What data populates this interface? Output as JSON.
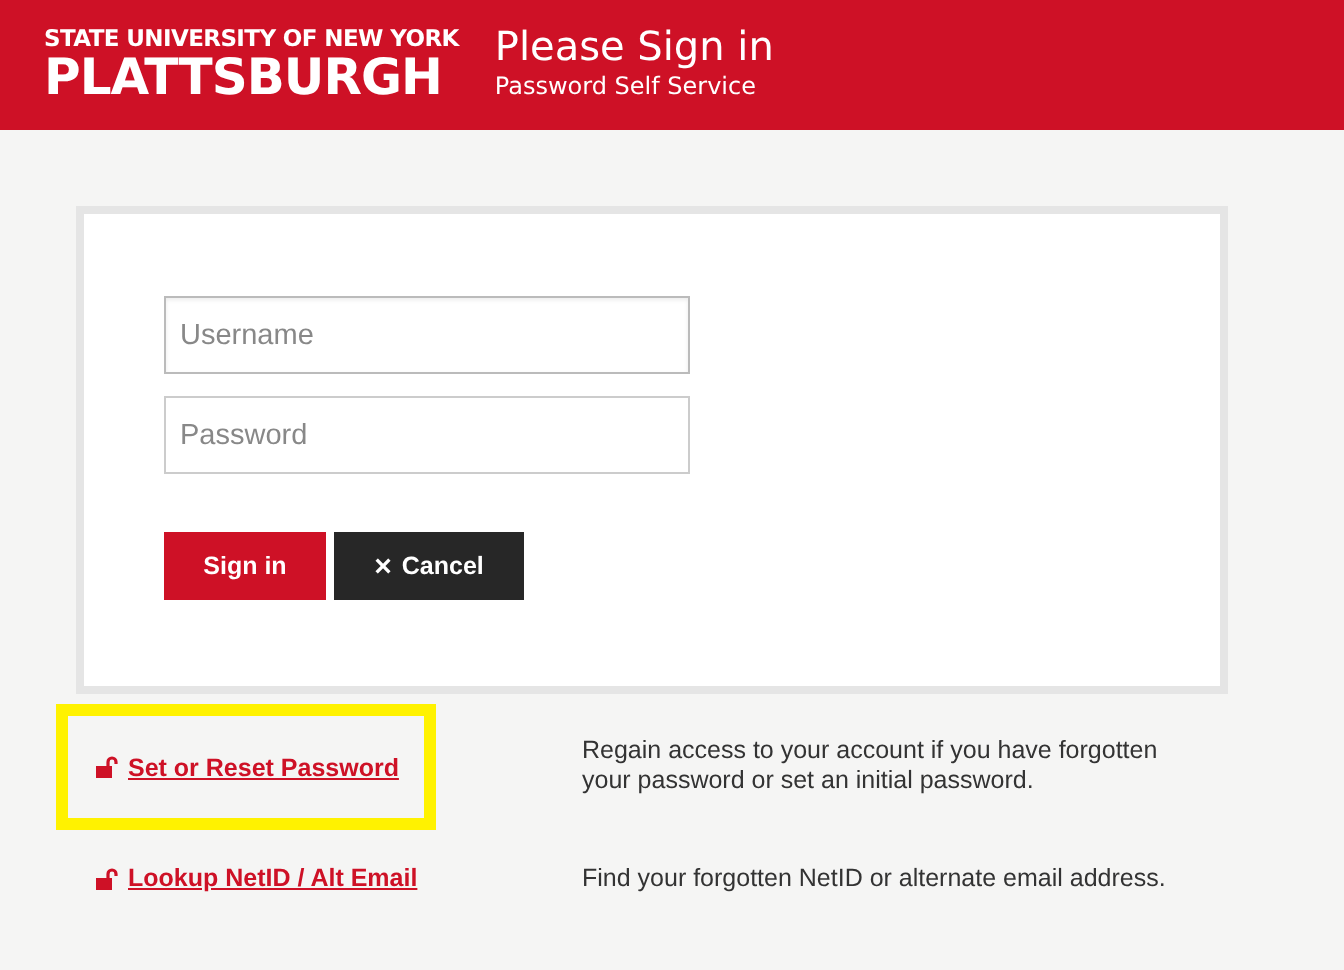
{
  "header": {
    "logo_top": "STATE UNIVERSITY OF NEW YORK",
    "logo_bottom": "PLATTSBURGH",
    "title": "Please Sign in",
    "subtitle": "Password Self Service"
  },
  "form": {
    "fields": [
      {
        "placeholder": "Username",
        "focused": true
      },
      {
        "placeholder": "Password",
        "focused": false
      }
    ],
    "buttons": [
      {
        "kind": "primary",
        "label": "Sign in"
      },
      {
        "kind": "dark",
        "label": "Cancel",
        "icon": "×"
      }
    ]
  },
  "links": [
    {
      "label": "Set or Reset Password",
      "description": "Regain access to your account if you have forgotten your password or set an initial password.",
      "highlighted": true
    },
    {
      "label": "Lookup NetID / Alt Email",
      "description": "Find your forgotten NetID or alternate email address.",
      "highlighted": false
    }
  ]
}
